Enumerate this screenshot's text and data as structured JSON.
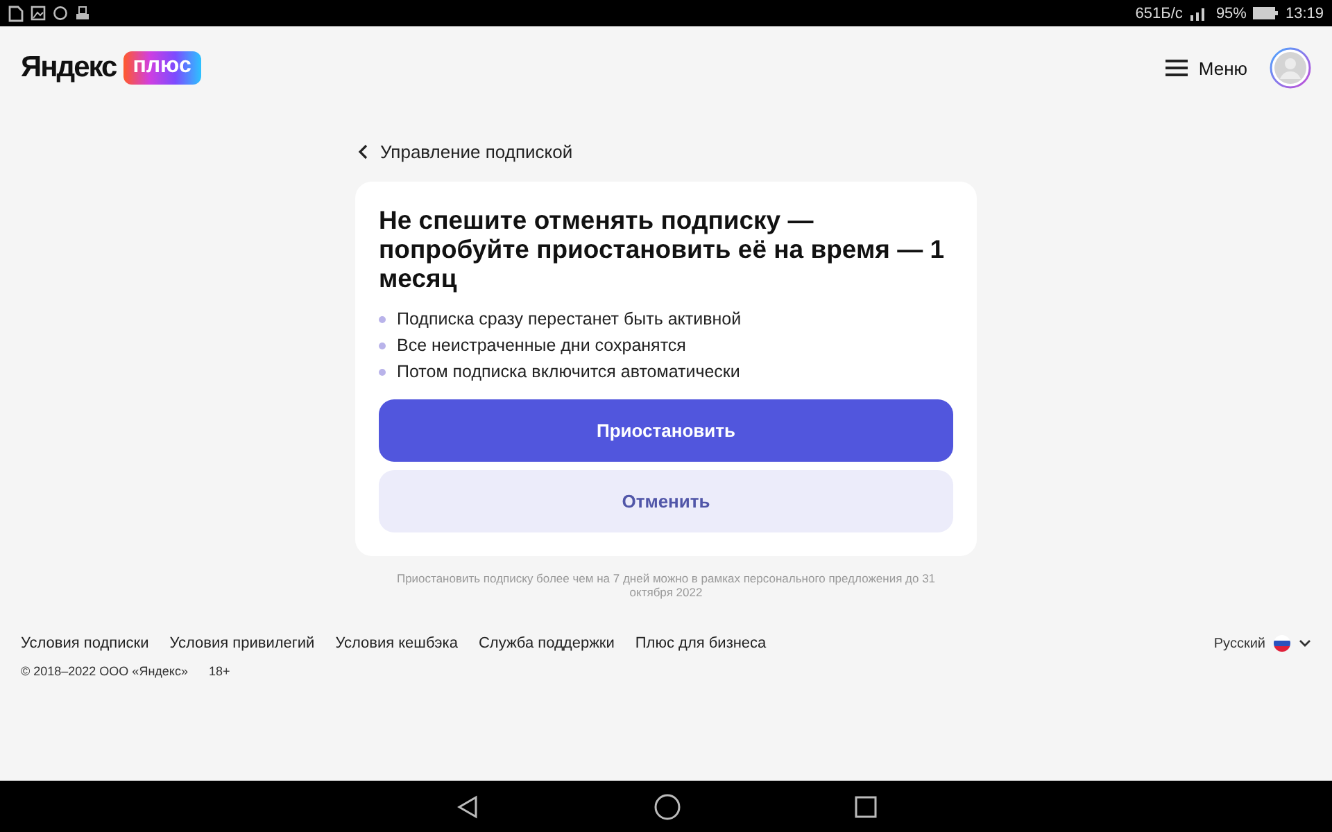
{
  "status_bar": {
    "speed": "651Б/с",
    "battery": "95%",
    "time": "13:19"
  },
  "header": {
    "logo_word": "Яндекс",
    "logo_badge": "плюс",
    "menu_label": "Меню"
  },
  "back_link": "Управление подпиской",
  "card": {
    "title": "Не спешите отменять подписку — попробуйте приостановить её на время — 1 месяц",
    "bullets": [
      "Подписка сразу перестанет быть активной",
      "Все неистраченные дни сохранятся",
      "Потом подписка включится автоматически"
    ],
    "buttons": [
      {
        "label": "Приостановить",
        "kind": "primary"
      },
      {
        "label": "Отменить",
        "kind": "secondary"
      }
    ]
  },
  "note": "Приостановить подписку более чем на 7 дней можно в рамках персонального предложения до 31 октября 2022",
  "footer": {
    "links": [
      "Условия подписки",
      "Условия привилегий",
      "Условия кешбэка",
      "Служба поддержки",
      "Плюс для бизнеса"
    ],
    "copyright": "© 2018–2022 ООО «Яндекс»",
    "age": "18+",
    "language": "Русский"
  }
}
